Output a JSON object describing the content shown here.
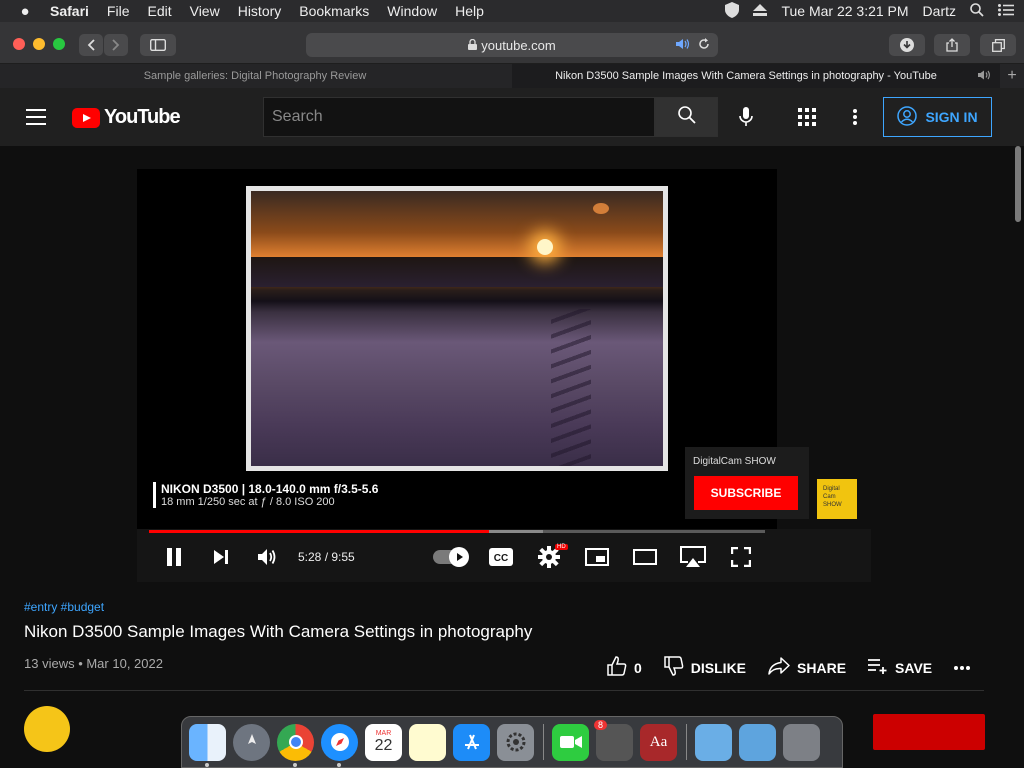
{
  "menubar": {
    "items": [
      "Safari",
      "File",
      "Edit",
      "View",
      "History",
      "Bookmarks",
      "Window",
      "Help"
    ],
    "clock": "Tue Mar 22  3:21 PM",
    "user": "Dartz"
  },
  "toolbar": {
    "url": "youtube.com"
  },
  "tabs": [
    {
      "title": "Sample galleries: Digital Photography Review",
      "active": false
    },
    {
      "title": "Nikon D3500 Sample Images With Camera Settings in photography - YouTube",
      "active": true
    }
  ],
  "youtube": {
    "logo_text": "YouTube",
    "search_placeholder": "Search",
    "sign_in": "SIGN IN"
  },
  "player": {
    "caption_line1": "NIKON D3500 | 18.0-140.0 mm f/3.5-5.6",
    "caption_line2": "18 mm 1/250 sec at ƒ / 8.0 ISO 200",
    "endcard_channel": "DigitalCam SHOW",
    "endcard_subscribe": "SUBSCRIBE",
    "channel_logo_text": "Digital Cam SHOW",
    "time": "5:28 / 9:55",
    "progress_fraction": 0.552,
    "buffered_fraction": 0.64,
    "hd_badge": "HD",
    "cc_label": "CC"
  },
  "video": {
    "tags": "#entry #budget",
    "title": "Nikon D3500 Sample Images With Camera Settings in photography",
    "views_date": "13 views • Mar 10, 2022",
    "like_count": "0",
    "dislike": "DISLIKE",
    "share": "SHARE",
    "save": "SAVE"
  },
  "dock": {
    "calendar_month": "MAR",
    "calendar_day": "22",
    "mail_badge": "8",
    "dictionary_label": "Aa"
  },
  "colors": {
    "yt_red": "#ff0000",
    "link_blue": "#3ea6ff"
  }
}
